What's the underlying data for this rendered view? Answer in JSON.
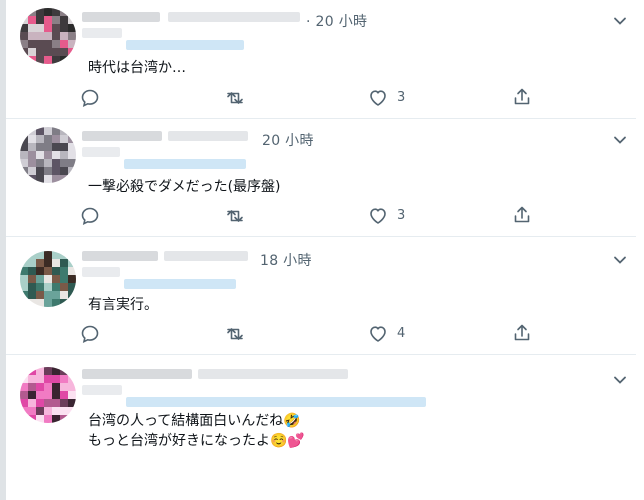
{
  "feed": {
    "replies": [
      {
        "time": "20 小時",
        "time_prefix": "·",
        "text": "時代は台湾か…",
        "likes": "3",
        "avatar_palette": [
          "#2b2b2b",
          "#5a4b52",
          "#8a7f86",
          "#c9b3bf",
          "#e65b8c",
          "#d9d4d7",
          "#3e3a3d"
        ]
      },
      {
        "time": "20 小時",
        "time_prefix": "",
        "text": "一撃必殺でダメだった(最序盤)",
        "likes": "3",
        "avatar_palette": [
          "#4a4850",
          "#7f7d86",
          "#b8b6be",
          "#e2e0e6",
          "#9c8f9e",
          "#5d5565",
          "#cfcdd4"
        ]
      },
      {
        "time": "18 小時",
        "time_prefix": "",
        "text": "有言実行。",
        "likes": "4",
        "avatar_palette": [
          "#2f5a52",
          "#3e7a6e",
          "#6aa39a",
          "#a9cfc8",
          "#3b2b24",
          "#7a5a48",
          "#e9e6e3"
        ]
      },
      {
        "time": "",
        "time_prefix": "",
        "text": "台湾の人って結構面白いんだね🤣\nもっと台湾が好きになったよ☺️💕",
        "likes": "",
        "avatar_palette": [
          "#e048a6",
          "#f17bc3",
          "#f7b6dc",
          "#6b3d5a",
          "#b35a8f",
          "#fbe1f1",
          "#3a2431"
        ]
      }
    ]
  }
}
